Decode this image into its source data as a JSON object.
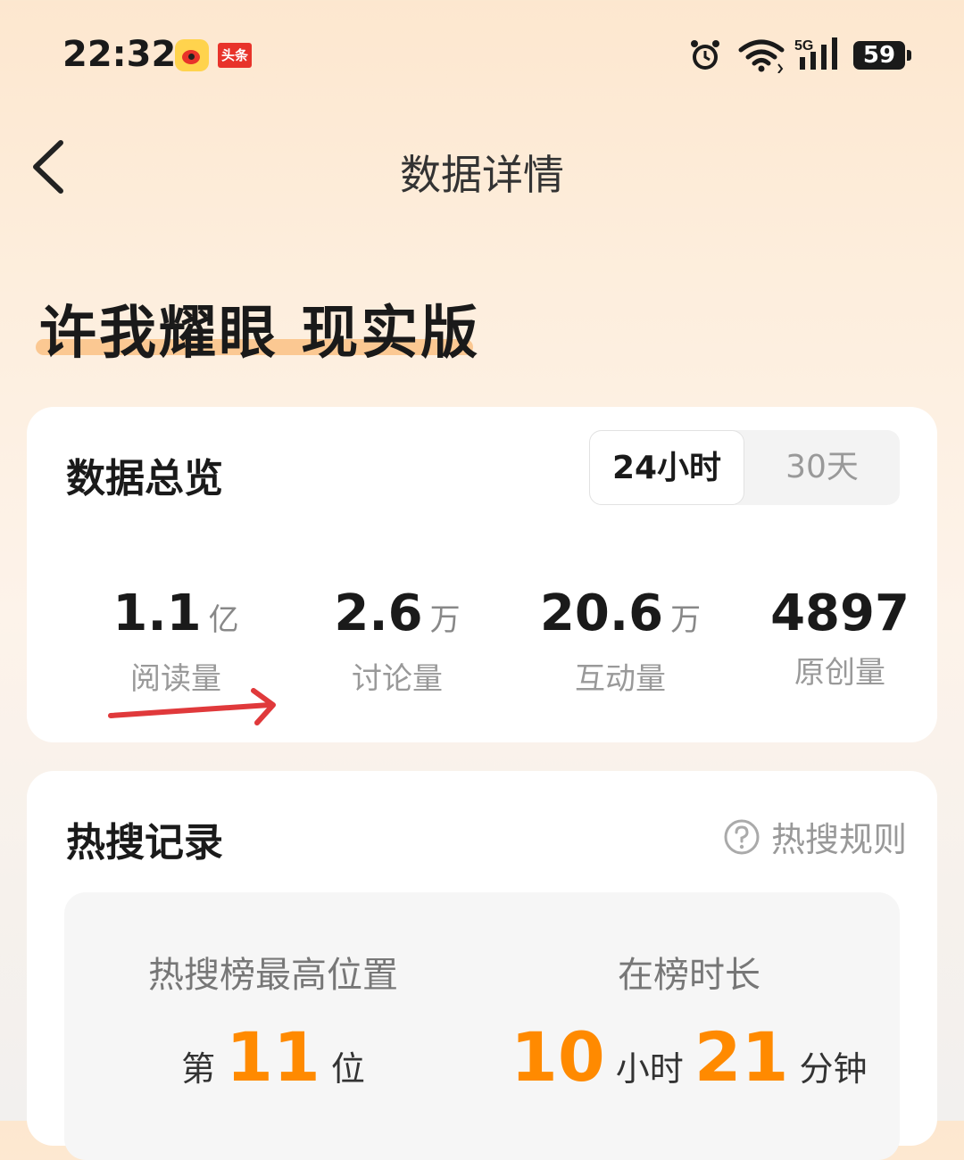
{
  "status_bar": {
    "time": "22:32",
    "app_icons": [
      "weibo-icon",
      "toutiao-icon"
    ],
    "toutiao_label": "头条",
    "network": "5G",
    "battery": "59"
  },
  "header": {
    "title": "数据详情",
    "back_icon": "chevron-left-icon"
  },
  "topic": {
    "title": "许我耀眼 现实版",
    "underline_color": "#fbc892"
  },
  "overview": {
    "title": "数据总览",
    "tabs": [
      {
        "label": "24小时",
        "selected": true
      },
      {
        "label": "30天",
        "selected": false
      }
    ],
    "stats": [
      {
        "value": "1.1",
        "unit": "亿",
        "label": "阅读量"
      },
      {
        "value": "2.6",
        "unit": "万",
        "label": "讨论量"
      },
      {
        "value": "20.6",
        "unit": "万",
        "label": "互动量"
      },
      {
        "value": "4897",
        "unit": "",
        "label": "原创量"
      }
    ],
    "annotation_color": "#e0393b"
  },
  "hot_search": {
    "title": "热搜记录",
    "rules_label": "热搜规则",
    "highest_position": {
      "label": "热搜榜最高位置",
      "prefix": "第",
      "value": "11",
      "suffix": "位"
    },
    "duration": {
      "label": "在榜时长",
      "hours": "10",
      "hours_unit": "小时",
      "minutes": "21",
      "minutes_unit": "分钟"
    },
    "accent_color": "#ff8a00"
  }
}
